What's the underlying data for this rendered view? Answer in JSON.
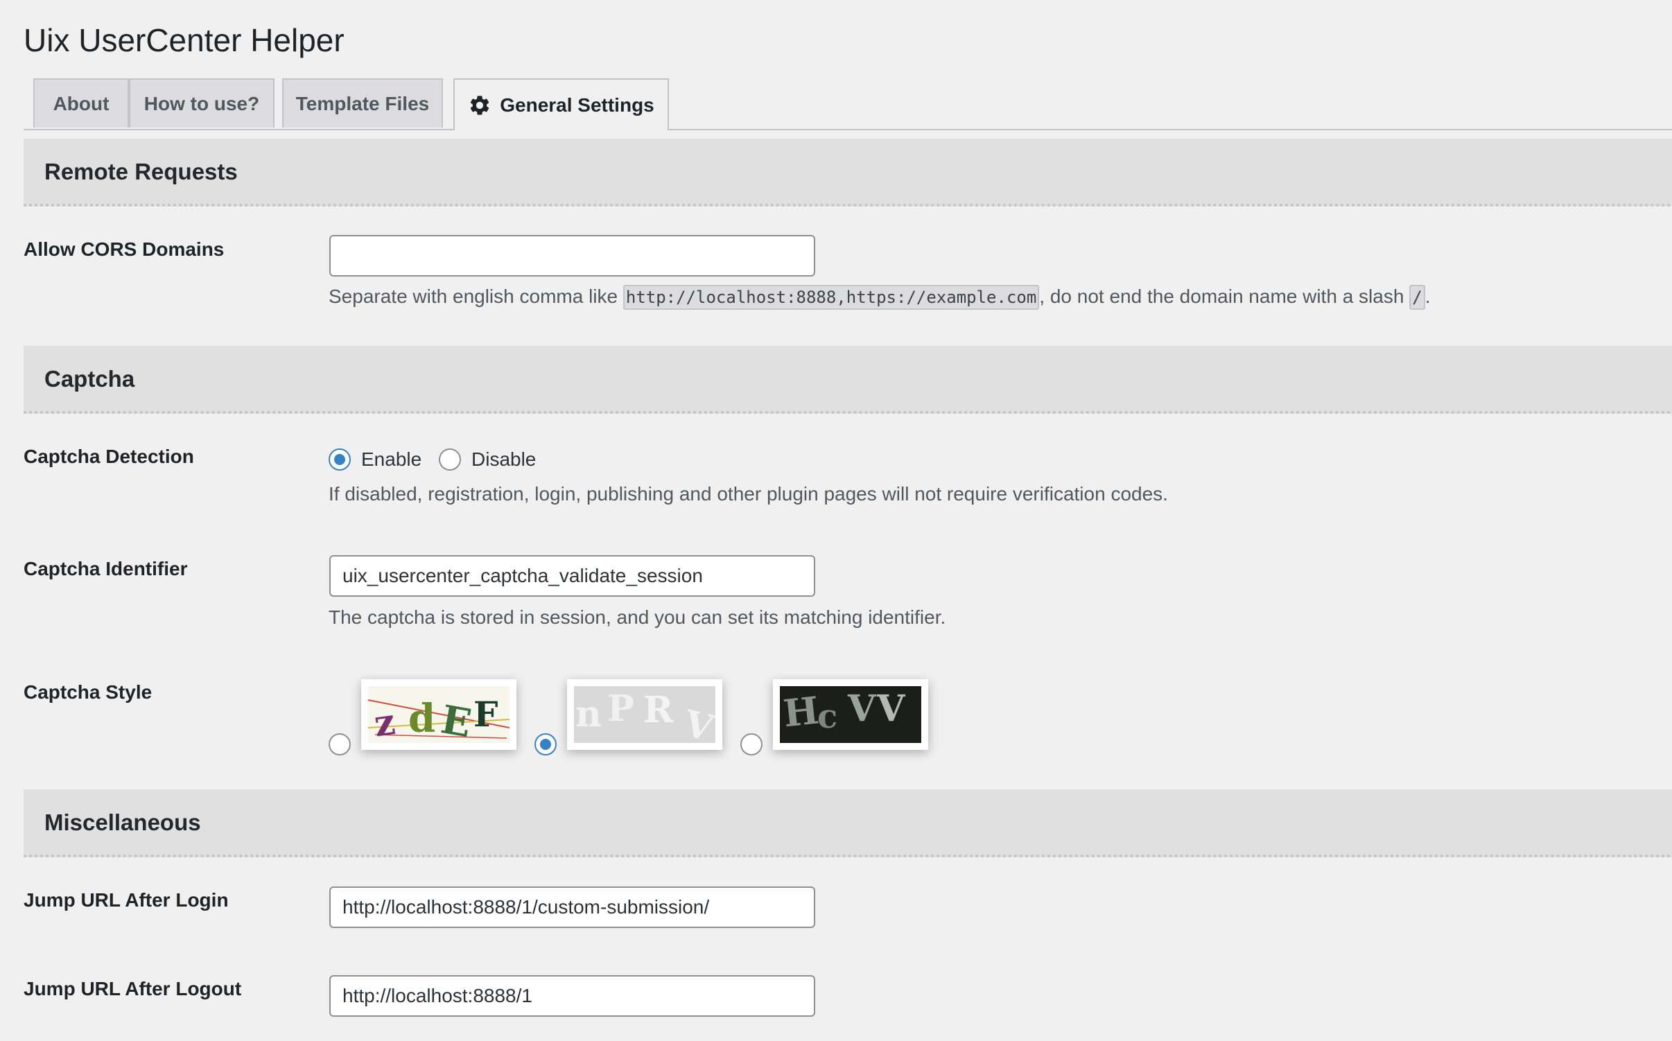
{
  "page": {
    "title": "Uix UserCenter Helper"
  },
  "tabs": [
    {
      "label": "About",
      "active": false
    },
    {
      "label": "How to use?",
      "active": false
    },
    {
      "label": "Template Files",
      "active": false
    },
    {
      "label": "General Settings",
      "active": true,
      "icon": "gear-icon"
    }
  ],
  "sections": {
    "remote": {
      "title": "Remote Requests",
      "cors": {
        "label": "Allow CORS Domains",
        "value": "",
        "desc_prefix": "Separate with english comma like ",
        "desc_code": "http://localhost:8888,https://example.com",
        "desc_middle": ", do not end the domain name with a slash ",
        "desc_code2": "/",
        "desc_suffix": "."
      }
    },
    "captcha": {
      "title": "Captcha",
      "detection": {
        "label": "Captcha Detection",
        "options": [
          "Enable",
          "Disable"
        ],
        "selected": "Enable",
        "desc": "If disabled, registration, login, publishing and other plugin pages will not require verification codes."
      },
      "identifier": {
        "label": "Captcha Identifier",
        "value": "uix_usercenter_captcha_validate_session",
        "desc": "The captcha is stored in session, and you can set its matching identifier."
      },
      "style": {
        "label": "Captcha Style",
        "options": [
          {
            "sample_text": "zdEF",
            "selected": false
          },
          {
            "sample_text": "nPRV",
            "selected": true
          },
          {
            "sample_text": "HcVV",
            "selected": false
          }
        ]
      }
    },
    "misc": {
      "title": "Miscellaneous",
      "login_url": {
        "label": "Jump URL After Login",
        "value": "http://localhost:8888/1/custom-submission/"
      },
      "logout_url": {
        "label": "Jump URL After Logout",
        "value": "http://localhost:8888/1"
      }
    }
  },
  "colors": {
    "accent": "#3582c4",
    "section_bg": "#e0e0e0",
    "page_bg": "#f0f0f1"
  }
}
